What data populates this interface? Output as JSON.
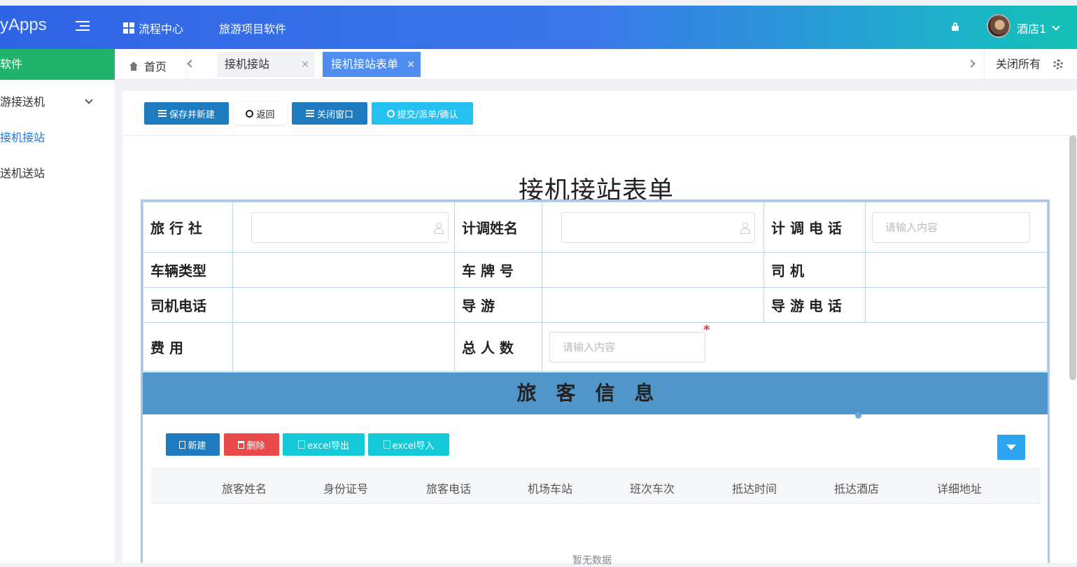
{
  "app": {
    "logo": "yApps"
  },
  "topnav": {
    "item1": "流程中心",
    "item2": "旅游项目软件",
    "user": "酒店1"
  },
  "sidebar": {
    "header": "软件",
    "items": [
      {
        "label": "游接送机"
      },
      {
        "label": "接机接站"
      },
      {
        "label": "送机送站"
      }
    ]
  },
  "tabs": {
    "home": "首页",
    "tab1": "接机接站",
    "tab2": "接机接站表单",
    "close_x": "×",
    "close_all": "关闭所有"
  },
  "toolbar": {
    "save_new": "保存并新建",
    "back": "返回",
    "close_window": "关闭窗口",
    "submit": "提交/派单/确认"
  },
  "form": {
    "title": "接机接站表单",
    "labels": {
      "agency": "旅 行 社",
      "planner_name": "计调姓名",
      "planner_phone": "计 调 电 话",
      "vehicle_type": "车辆类型",
      "plate": "车 牌 号",
      "driver": "司 机",
      "driver_phone": "司机电话",
      "guide": "导 游",
      "guide_phone": "导 游 电 话",
      "fee": "费 用",
      "total": "总 人 数"
    },
    "placeholder": "请输入内容",
    "required_mark": "*"
  },
  "passengers": {
    "title": "旅客信息",
    "buttons": {
      "new": "新建",
      "delete": "删除",
      "export": "excel导出",
      "import": "excel导入"
    },
    "columns": [
      "旅客姓名",
      "身份证号",
      "旅客电话",
      "机场车站",
      "班次车次",
      "抵达时间",
      "抵达酒店",
      "详细地址"
    ],
    "empty": "暂无数据"
  }
}
